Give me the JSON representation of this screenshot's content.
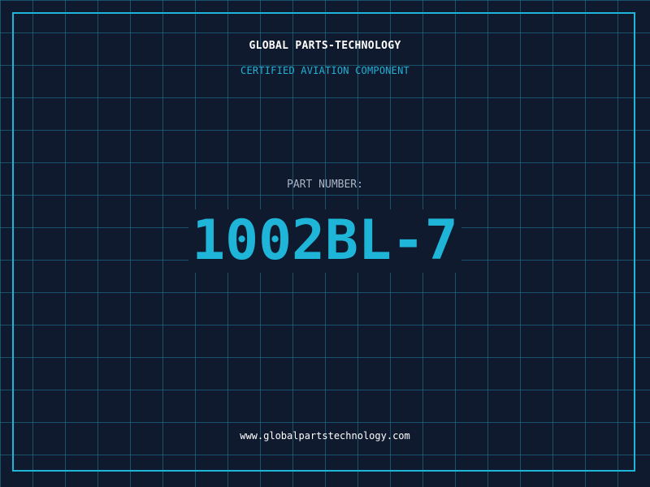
{
  "header": {
    "brand": "GLOBAL PARTS-TECHNOLOGY",
    "subtitle": "CERTIFIED AVIATION COMPONENT"
  },
  "part": {
    "label": "PART NUMBER:",
    "number": "1002BL-7"
  },
  "footer": {
    "website": "www.globalpartstechnology.com"
  },
  "colors": {
    "background": "#0f1a2e",
    "grid": "#2896b4",
    "accent": "#1eb5d8",
    "text": "#ffffff",
    "label": "#aab4c4"
  }
}
